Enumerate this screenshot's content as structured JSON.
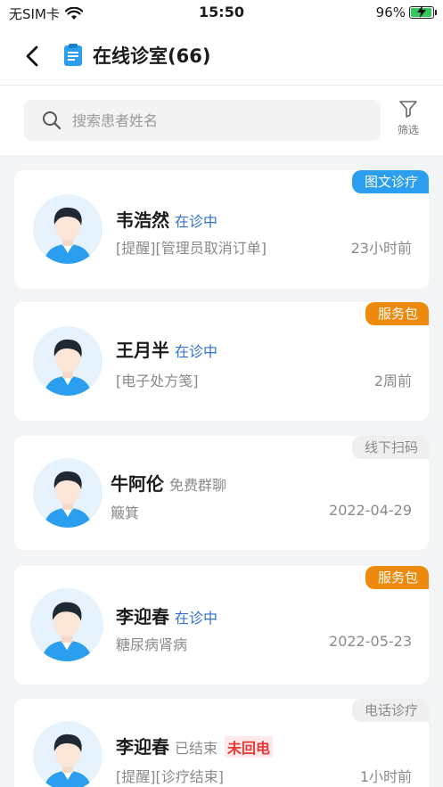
{
  "status_bar": {
    "carrier": "无SIM卡",
    "time": "15:50",
    "battery": "96%"
  },
  "nav": {
    "title": "在线诊室(66)"
  },
  "search": {
    "placeholder": "搜索患者姓名",
    "filter_label": "筛选"
  },
  "colors": {
    "accent_blue": "#2f6fdb",
    "tag_blue": "#2c9ef0",
    "tag_orange": "#ed8a0c",
    "alert_red": "#e53935"
  },
  "patients": [
    {
      "name": "韦浩然",
      "status": "在诊中",
      "message": "[提醒][管理员取消订单]",
      "time": "23小时前",
      "tag": "图文诊疗"
    },
    {
      "name": "王月半",
      "status": "在诊中",
      "message": "[电子处方笺]",
      "time": "2周前",
      "tag": "服务包"
    },
    {
      "name": "牛阿伦",
      "status": "免费群聊",
      "message": "簸箕",
      "time": "2022-04-29",
      "tag": "线下扫码"
    },
    {
      "name": "李迎春",
      "status": "在诊中",
      "message": "糖尿病肾病",
      "time": "2022-05-23",
      "tag": "服务包"
    },
    {
      "name": "李迎春",
      "status": "已结束",
      "alert": "未回电",
      "message": "[提醒][诊疗结束]",
      "time": "1小时前",
      "tag": "电话诊疗"
    }
  ]
}
